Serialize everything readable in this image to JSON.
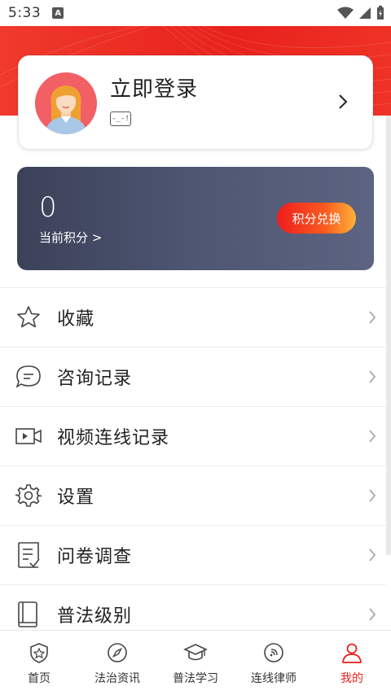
{
  "status_bar": {
    "time": "5:33",
    "notification_glyph": "A"
  },
  "profile": {
    "login_label": "立即登录",
    "badge_text": "-_-!"
  },
  "points": {
    "value": "0",
    "label": "当前积分 >",
    "redeem_label": "积分兑换"
  },
  "menu": {
    "items": [
      {
        "label": "收藏",
        "icon": "star-icon"
      },
      {
        "label": "咨询记录",
        "icon": "chat-bubble-icon"
      },
      {
        "label": "视频连线记录",
        "icon": "video-camera-icon"
      },
      {
        "label": "设置",
        "icon": "gear-icon"
      },
      {
        "label": "问卷调查",
        "icon": "survey-icon"
      },
      {
        "label": "普法级别",
        "icon": "book-icon"
      }
    ]
  },
  "tabs": [
    {
      "label": "首页",
      "icon": "home-shield-icon",
      "active": false
    },
    {
      "label": "法治资讯",
      "icon": "compass-icon",
      "active": false
    },
    {
      "label": "普法学习",
      "icon": "graduation-cap-icon",
      "active": false
    },
    {
      "label": "连线律师",
      "icon": "signal-bubble-icon",
      "active": false
    },
    {
      "label": "我的",
      "icon": "person-icon",
      "active": true
    }
  ],
  "colors": {
    "accent": "#e8221d",
    "points_card": "#4a5069"
  }
}
